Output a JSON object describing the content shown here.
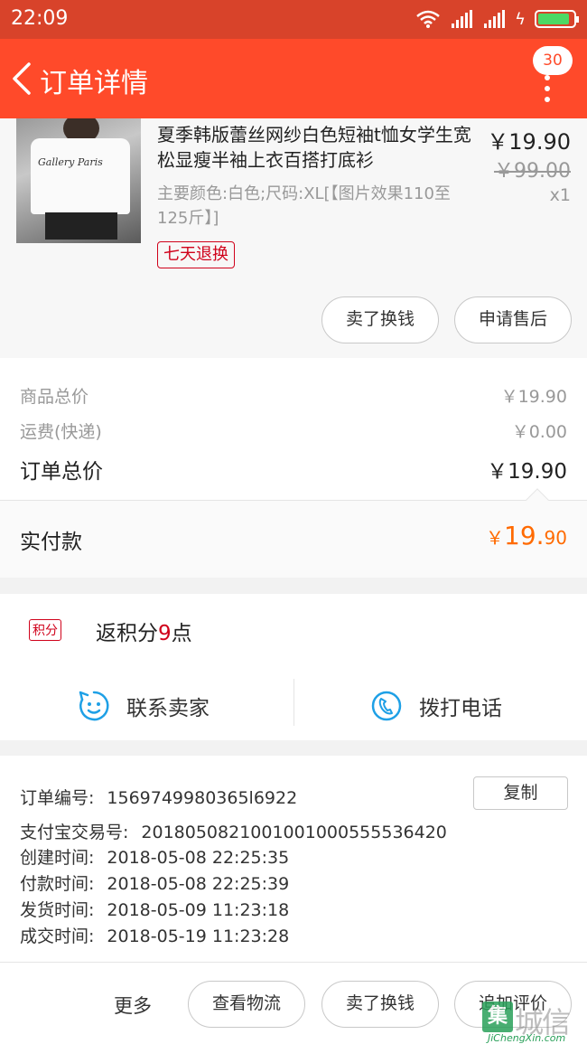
{
  "status_bar": {
    "time": "22:09",
    "battery_level": 0.9,
    "battery_color": "#4cd964"
  },
  "nav": {
    "title": "订单详情",
    "cart_badge": "30"
  },
  "product": {
    "image_text": "Gallery Paris",
    "title": "夏季韩版蕾丝网纱白色短袖t恤女学生宽松显瘦半袖上衣百搭打底衫",
    "price": "￥19.90",
    "original_price": "￥99.00",
    "quantity": "x1",
    "spec": "主要颜色:白色;尺码:XL[【图片效果110至125斤】]",
    "return_tag": "七天退换",
    "btn_sell": "卖了换钱",
    "btn_aftersale": "申请售后"
  },
  "summary": {
    "goods_total_label": "商品总价",
    "goods_total": "￥19.90",
    "shipping_label": "运费(快递)",
    "shipping": "￥0.00",
    "order_total_label": "订单总价",
    "order_total": "￥19.90",
    "paid_label": "实付款",
    "paid_currency": "￥",
    "paid_int": "19.",
    "paid_dec": "90"
  },
  "points": {
    "tag": "积分",
    "text_before": "返积分",
    "value": "9",
    "text_after": "点"
  },
  "contact": {
    "seller": "联系卖家",
    "phone": "拨打电话"
  },
  "order_info": {
    "order_no_label": "订单编号:",
    "order_no": "1569749980365l6922",
    "copy": "复制",
    "alipay_label": "支付宝交易号:",
    "alipay_no": "2018050821001001000555536420",
    "created_label": "创建时间:",
    "created": "2018-05-08 22:25:35",
    "paid_label": "付款时间:",
    "paid": "2018-05-08 22:25:39",
    "shipped_label": "发货时间:",
    "shipped": "2018-05-09 11:23:18",
    "completed_label": "成交时间:",
    "completed": "2018-05-19 11:23:28"
  },
  "bottom_bar": {
    "more": "更多",
    "logistics": "查看物流",
    "sell": "卖了换钱",
    "review": "追加评价"
  },
  "watermark": {
    "mark": "集",
    "cn": "城信",
    "en": "JiChengXin.com"
  },
  "colors": {
    "brand": "#ff4a2a",
    "status_bar": "#d8432a",
    "accent_orange": "#ff6a00",
    "tag_red": "#d0021b",
    "contact_blue": "#1ea0e6"
  }
}
